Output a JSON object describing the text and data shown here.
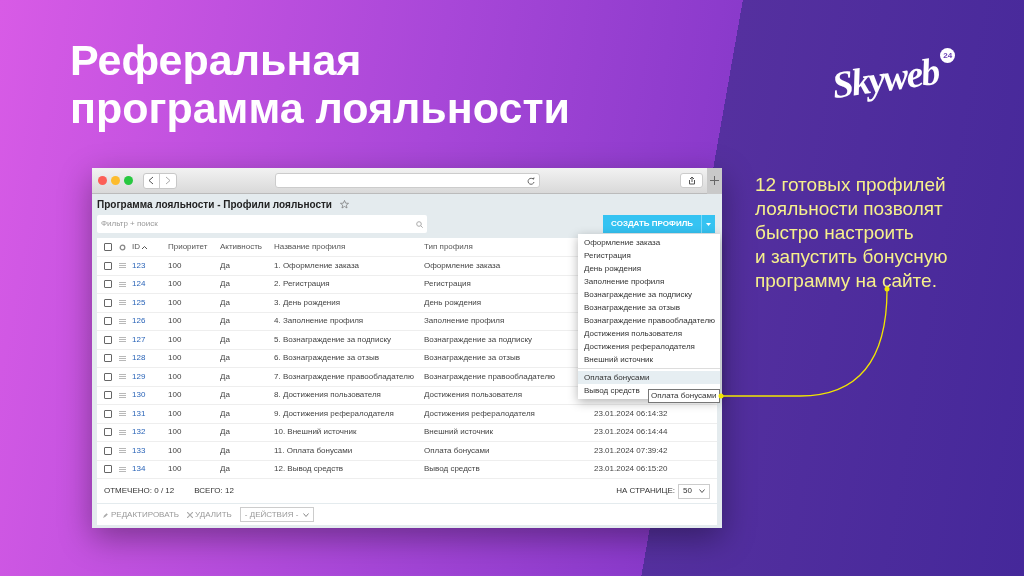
{
  "slide": {
    "heading": [
      "Реферальная",
      "программа лояльности"
    ],
    "logo": {
      "name": "Skyweb",
      "badge": "24"
    },
    "caption": [
      "12 готовых профилей",
      "лояльности позволят",
      "быстро настроить",
      "и запустить бонусную",
      "программу на сайте."
    ]
  },
  "page": {
    "title": "Программа лояльности - Профили лояльности",
    "favorite": false,
    "filter": {
      "placeholder": "Фильтр + поиск"
    },
    "create_button": "СОЗДАТЬ ПРОФИЛЬ",
    "table": {
      "header_checked": false,
      "columns": [
        "ID",
        "Приоритет",
        "Активность",
        "Название профиля",
        "Тип профиля"
      ],
      "rows": [
        {
          "checked": false,
          "id": "123",
          "priority": "100",
          "active": "Да",
          "name": "1. Оформление заказа",
          "type": "Оформление заказа"
        },
        {
          "checked": false,
          "id": "124",
          "priority": "100",
          "active": "Да",
          "name": "2. Регистрация",
          "type": "Регистрация"
        },
        {
          "checked": false,
          "id": "125",
          "priority": "100",
          "active": "Да",
          "name": "3. День рождения",
          "type": "День рождения"
        },
        {
          "checked": false,
          "id": "126",
          "priority": "100",
          "active": "Да",
          "name": "4. Заполнение профиля",
          "type": "Заполнение профиля"
        },
        {
          "checked": false,
          "id": "127",
          "priority": "100",
          "active": "Да",
          "name": "5. Вознаграждение за подписку",
          "type": "Вознаграждение за подписку"
        },
        {
          "checked": false,
          "id": "128",
          "priority": "100",
          "active": "Да",
          "name": "6. Вознаграждение за отзыв",
          "type": "Вознаграждение за отзыв"
        },
        {
          "checked": false,
          "id": "129",
          "priority": "100",
          "active": "Да",
          "name": "7. Вознаграждение правообладателю",
          "type": "Вознаграждение правообладателю"
        },
        {
          "checked": false,
          "id": "130",
          "priority": "100",
          "active": "Да",
          "name": "8. Достижения пользователя",
          "type": "Достижения пользователя"
        },
        {
          "checked": false,
          "id": "131",
          "priority": "100",
          "active": "Да",
          "name": "9. Достижения рефералодателя",
          "type": "Достижения рефералодателя",
          "date": "23.01.2024 06:14:32"
        },
        {
          "checked": false,
          "id": "132",
          "priority": "100",
          "active": "Да",
          "name": "10. Внешний источник",
          "type": "Внешний источник",
          "date": "23.01.2024 06:14:44"
        },
        {
          "checked": false,
          "id": "133",
          "priority": "100",
          "active": "Да",
          "name": "11. Оплата бонусами",
          "type": "Оплата бонусами",
          "date": "23.01.2024 07:39:42"
        },
        {
          "checked": false,
          "id": "134",
          "priority": "100",
          "active": "Да",
          "name": "12. Вывод средств",
          "type": "Вывод средств",
          "date": "23.01.2024 06:15:20"
        }
      ]
    },
    "footer": {
      "marked": "ОТМЕЧЕНО: 0 / 12",
      "total": "ВСЕГО: 12",
      "per_page_label": "НА СТРАНИЦЕ:",
      "per_page": "50"
    },
    "actions": {
      "edit": "РЕДАКТИРОВАТЬ",
      "delete": "УДАЛИТЬ",
      "select": "- ДЕЙСТВИЯ -"
    },
    "dropdown": {
      "sections": [
        {
          "items": [
            {
              "label": "Оформление заказа",
              "hovered": false
            },
            {
              "label": "Регистрация",
              "hovered": false
            },
            {
              "label": "День рождения",
              "hovered": false
            },
            {
              "label": "Заполнение профиля",
              "hovered": false
            },
            {
              "label": "Вознаграждение за подписку",
              "hovered": false
            },
            {
              "label": "Вознаграждение за отзыв",
              "hovered": false
            },
            {
              "label": "Вознаграждение правообладателю",
              "hovered": false
            },
            {
              "label": "Достижения пользователя",
              "hovered": false
            },
            {
              "label": "Достижения рефералодателя",
              "hovered": false
            },
            {
              "label": "Внешний источник",
              "hovered": false
            }
          ]
        },
        {
          "items": [
            {
              "label": "Оплата бонусами",
              "hovered": true
            },
            {
              "label": "Вывод средств",
              "hovered": false
            }
          ]
        }
      ]
    },
    "tooltip": "Оплата бонусами"
  }
}
